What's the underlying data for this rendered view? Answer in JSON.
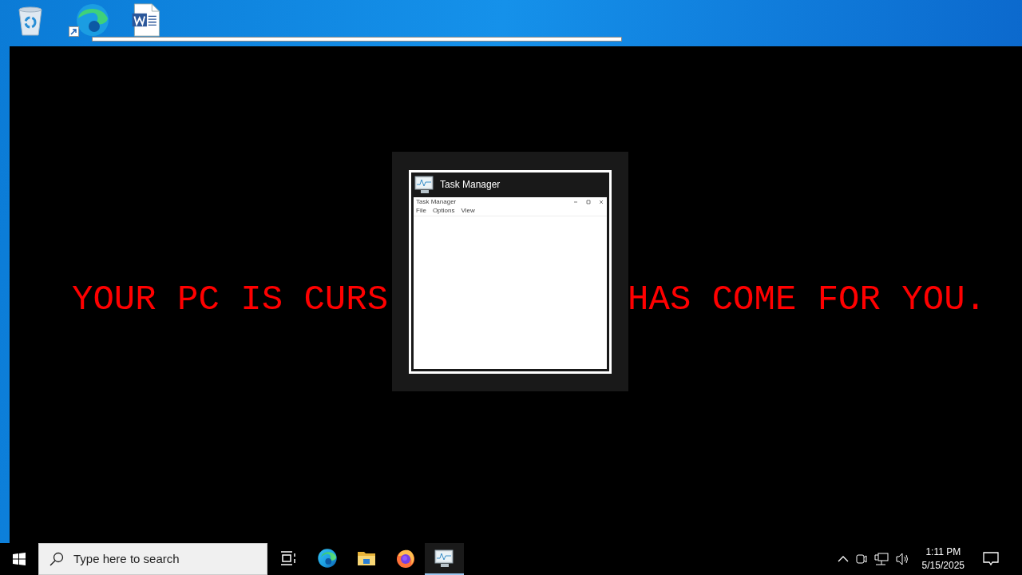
{
  "desktop": {
    "icons": [
      {
        "kind": "recycle"
      },
      {
        "kind": "edge"
      },
      {
        "kind": "word"
      }
    ]
  },
  "overlay": {
    "message_left": "YOUR PC IS CURS",
    "message_right": "HAS COME FOR YOU."
  },
  "switcher": {
    "title": "Task Manager",
    "thumbnail": {
      "title": "Task Manager",
      "menu": [
        "File",
        "Options",
        "View"
      ]
    }
  },
  "taskbar": {
    "search": {
      "placeholder": "Type here to search"
    },
    "apps": [
      {
        "kind": "taskview",
        "running": false
      },
      {
        "kind": "edge",
        "running": false
      },
      {
        "kind": "explorer",
        "running": false
      },
      {
        "kind": "firefox",
        "running": false
      },
      {
        "kind": "taskmgr",
        "running": true
      }
    ],
    "clock": {
      "time": "1:11 PM",
      "date": "5/15/2025"
    }
  }
}
